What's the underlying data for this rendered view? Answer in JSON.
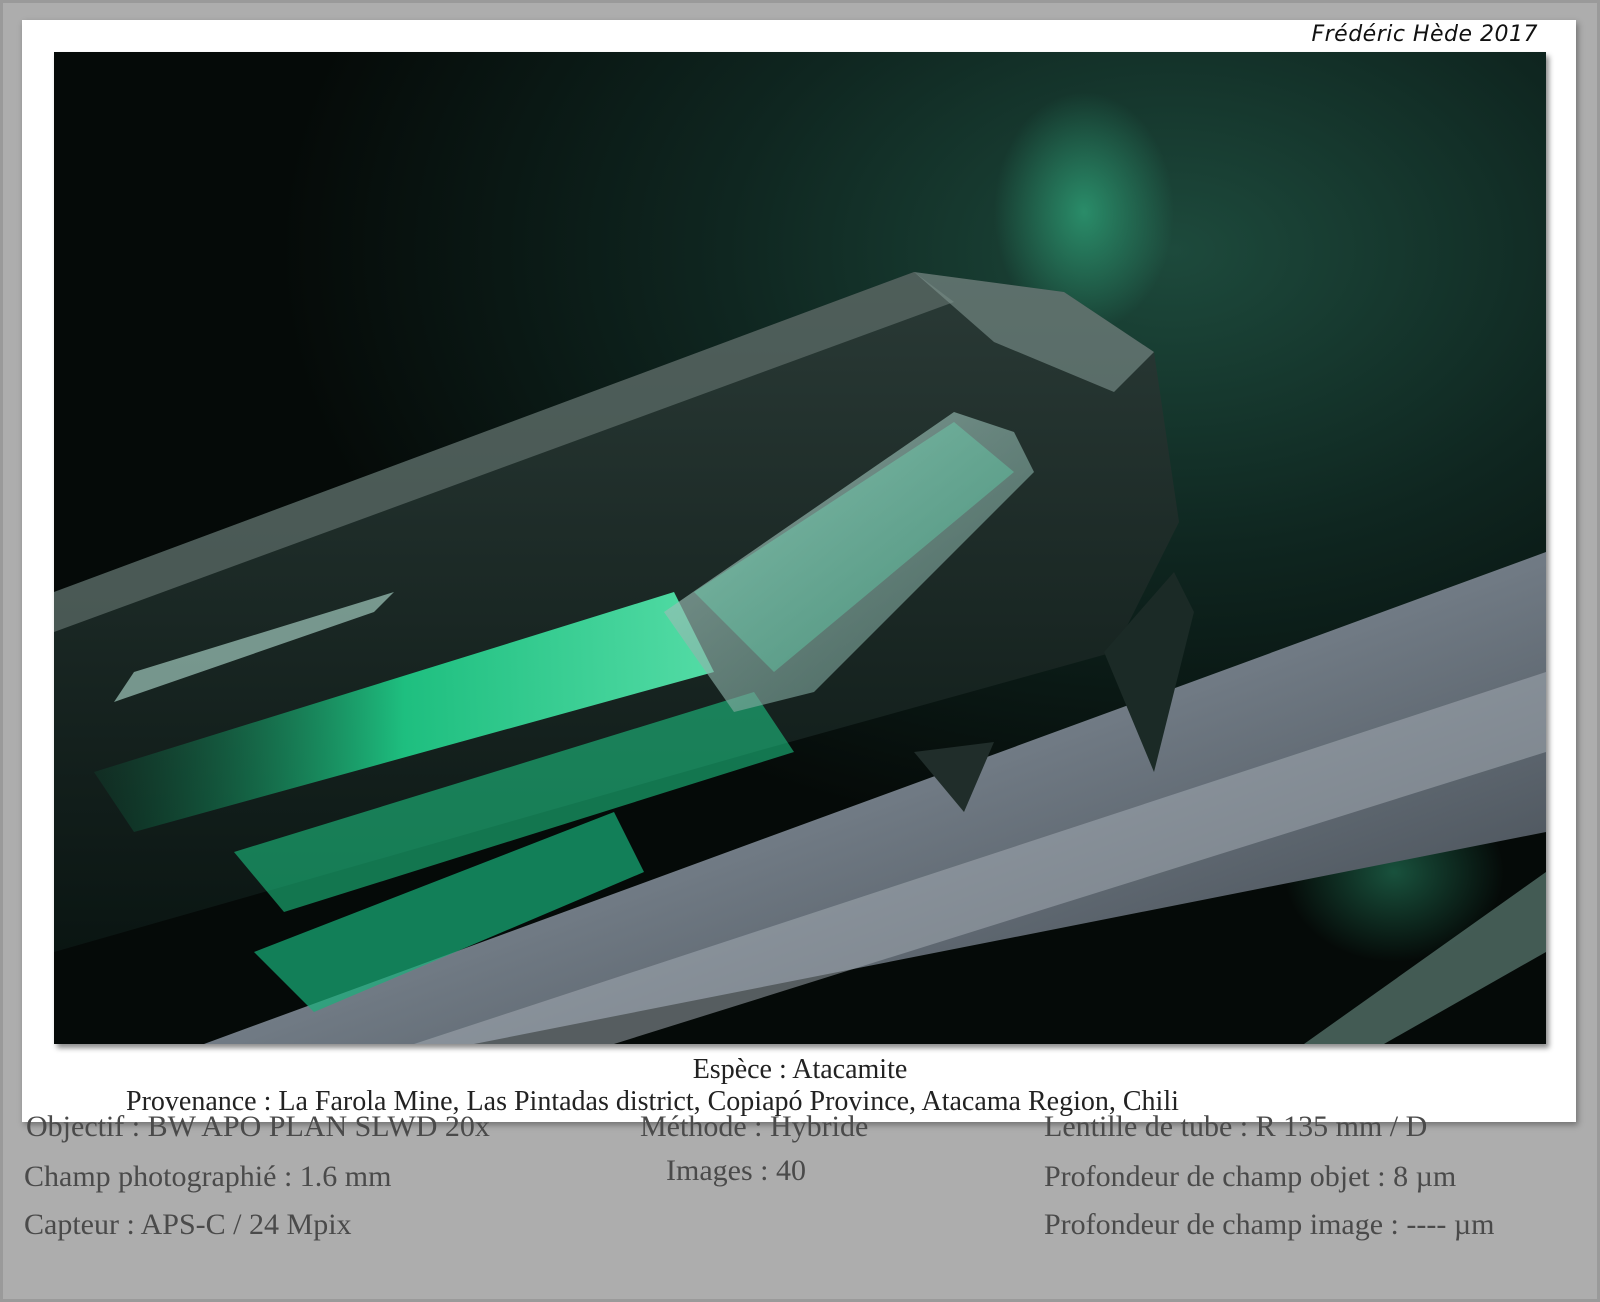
{
  "signature": "Frédéric Hède 2017",
  "caption": {
    "species": "Espèce : Atacamite",
    "locality": "Provenance : La Farola Mine, Las Pintadas district, Copiapó Province, Atacama Region, Chili"
  },
  "specs": {
    "objective": "Objectif : BW APO PLAN SLWD 20x",
    "field": "Champ photographié : 1.6 mm",
    "sensor": "Capteur : APS-C / 24 Mpix",
    "method": "Méthode : Hybride",
    "images": "Images : 40",
    "tube_lens": "Lentille de tube : R 135 mm / D",
    "object_dof": "Profondeur de champ objet : 8 µm",
    "image_dof": "Profondeur de champ image : ---- µm"
  },
  "colors": {
    "frame": "#adadad",
    "mat": "#ffffff",
    "crystal_green": "#1fd08a",
    "background_dark": "#0b1512",
    "matrix_grey": "#7c8791"
  }
}
